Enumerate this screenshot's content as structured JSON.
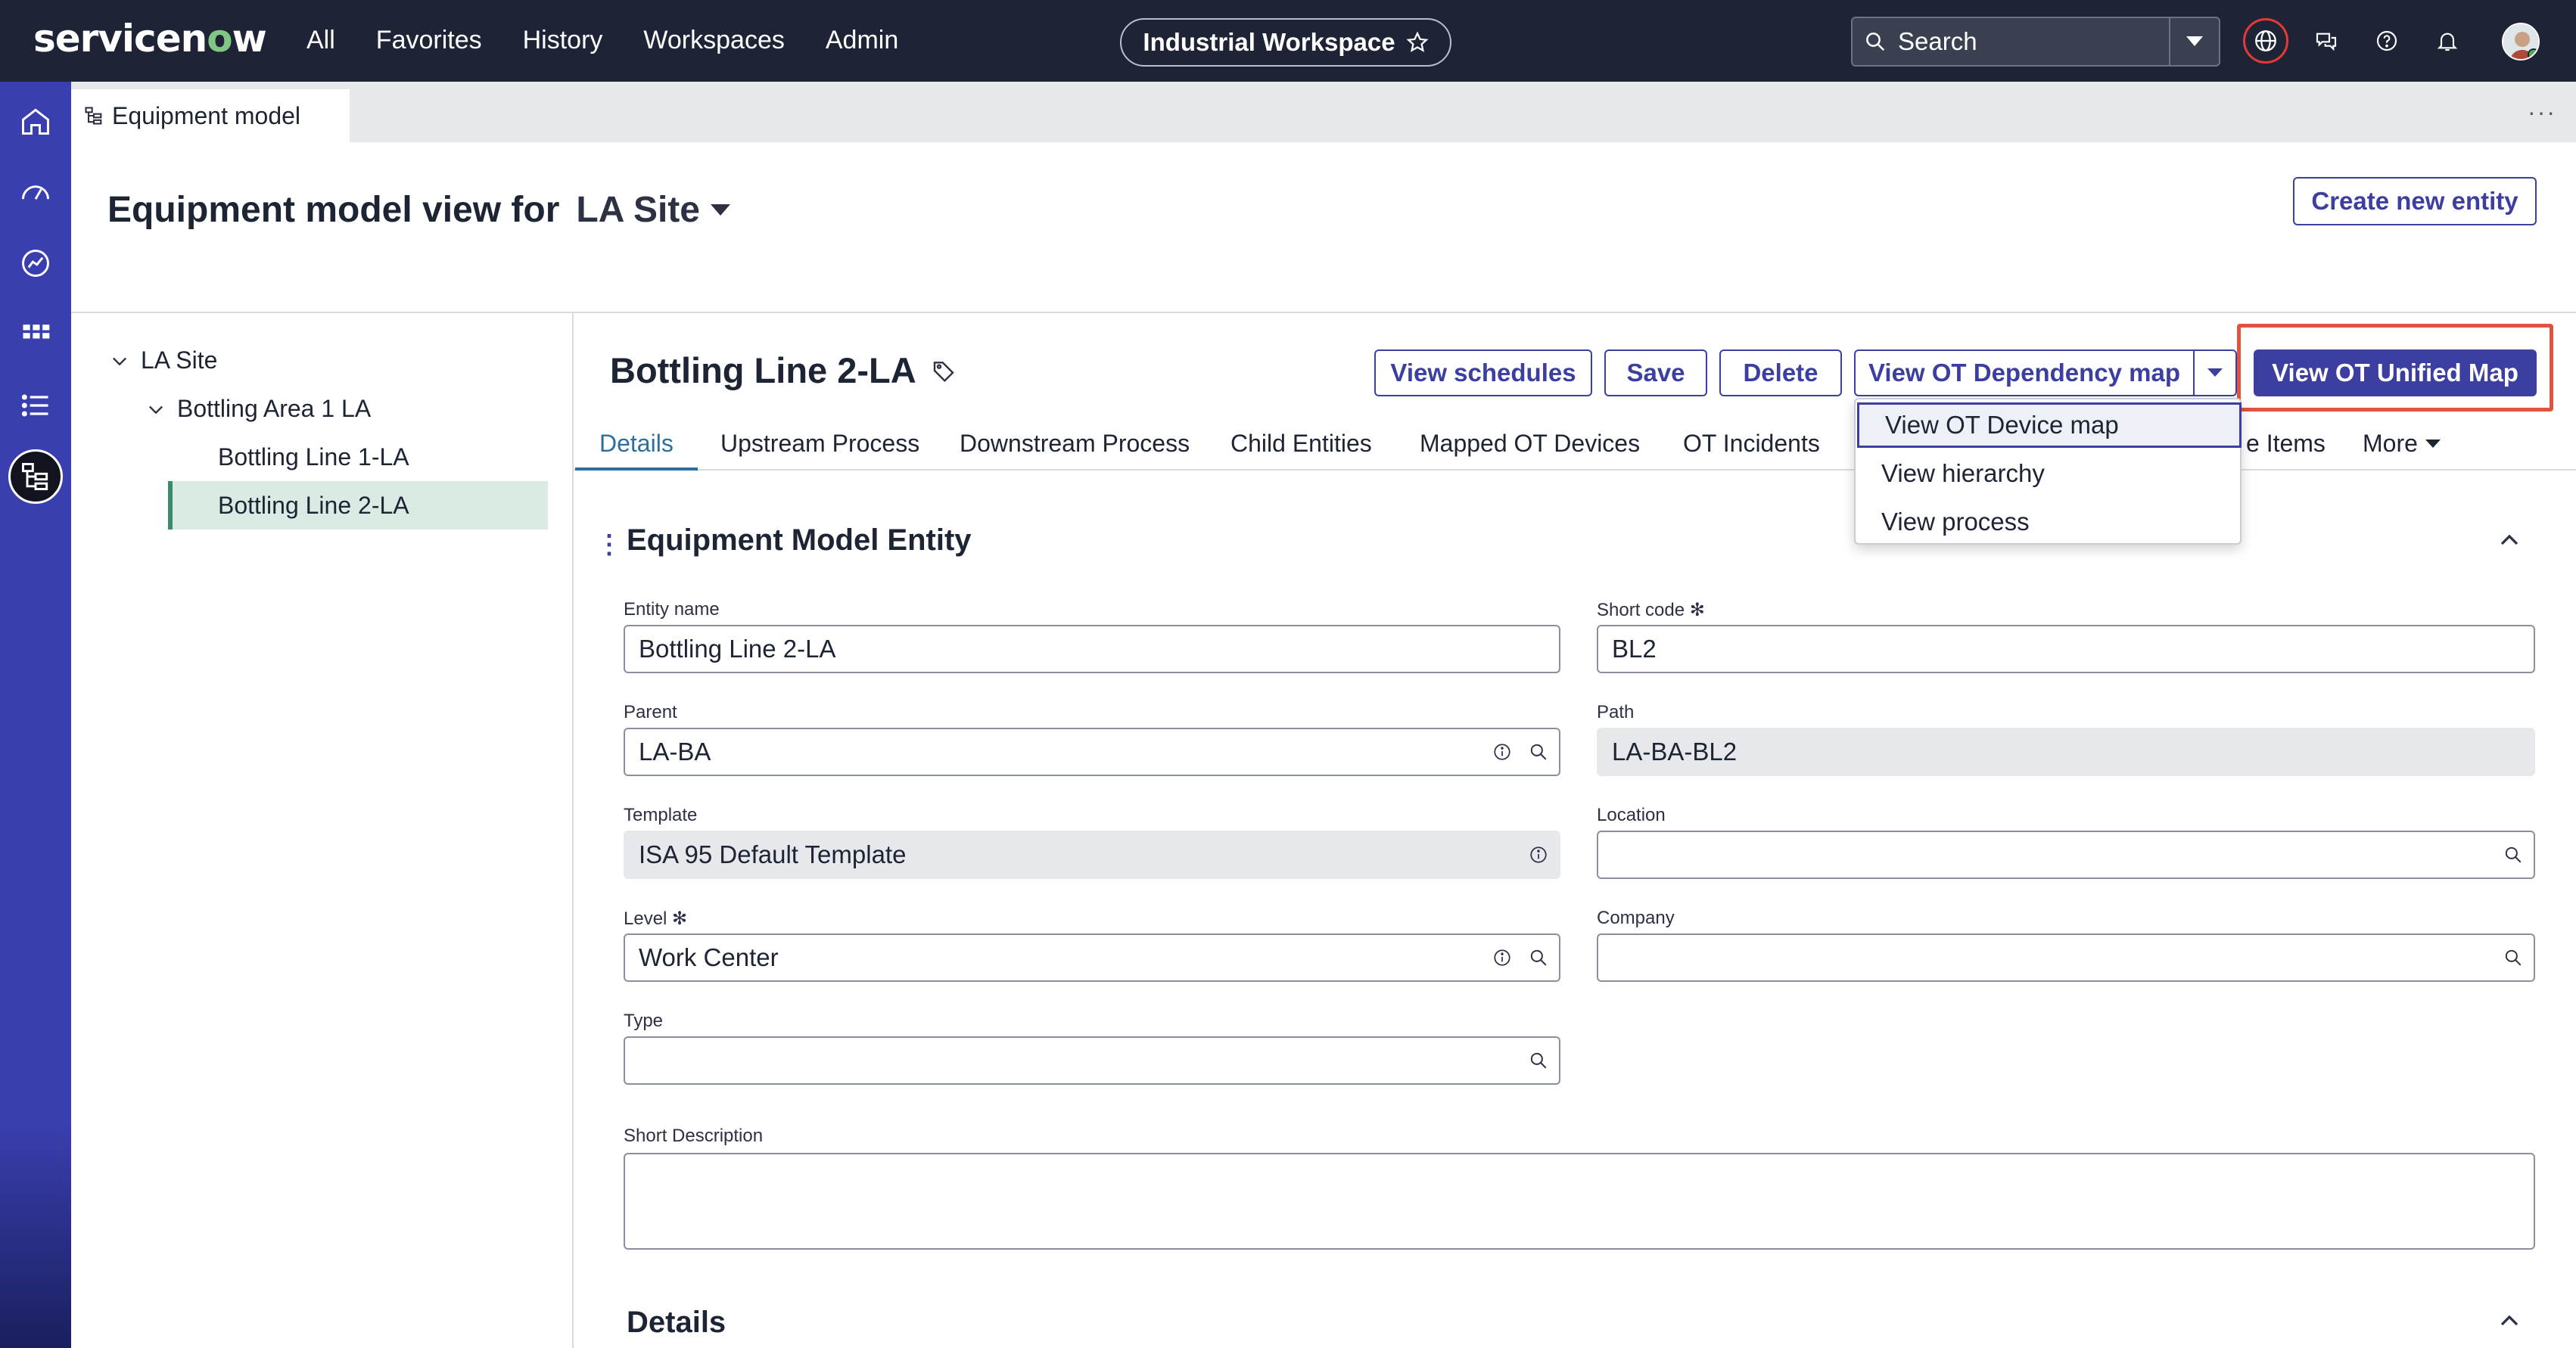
{
  "topnav": {
    "logo_prefix": "servicen",
    "logo_o": "o",
    "logo_suffix": "w",
    "links": [
      "All",
      "Favorites",
      "History",
      "Workspaces",
      "Admin"
    ],
    "workspace": "Industrial Workspace",
    "search_placeholder": "Search"
  },
  "tab": {
    "label": "Equipment model",
    "more": "···"
  },
  "header": {
    "title_prefix": "Equipment model view for",
    "site": "LA Site",
    "create_button": "Create new entity"
  },
  "tree": {
    "root": "LA Site",
    "area": "Bottling Area 1 LA",
    "line1": "Bottling Line 1-LA",
    "line2": "Bottling Line 2-LA"
  },
  "record": {
    "title": "Bottling Line 2-LA",
    "buttons": {
      "schedules": "View schedules",
      "save": "Save",
      "delete": "Delete",
      "dependency": "View OT Dependency map",
      "unified": "View OT Unified Map"
    },
    "tabs": [
      "Details",
      "Upstream Process",
      "Downstream Process",
      "Child Entities",
      "Mapped OT Devices",
      "OT Incidents",
      "e Items",
      "More"
    ],
    "dropdown": [
      "View OT Device map",
      "View hierarchy",
      "View process"
    ]
  },
  "section": {
    "title": "Equipment Model Entity",
    "details_title": "Details"
  },
  "fields": {
    "entity_name": {
      "label": "Entity name",
      "value": "Bottling Line 2-LA"
    },
    "short_code": {
      "label": "Short code",
      "value": "BL2"
    },
    "parent": {
      "label": "Parent",
      "value": "LA-BA"
    },
    "path": {
      "label": "Path",
      "value": "LA-BA-BL2"
    },
    "template": {
      "label": "Template",
      "value": "ISA 95 Default Template"
    },
    "location": {
      "label": "Location",
      "value": ""
    },
    "level": {
      "label": "Level",
      "value": "Work Center"
    },
    "company": {
      "label": "Company",
      "value": ""
    },
    "type": {
      "label": "Type",
      "value": ""
    },
    "short_description": {
      "label": "Short Description",
      "value": ""
    }
  },
  "colors": {
    "nav_bg": "#1e2436",
    "rail": "#3a3fb0",
    "primary": "#3c3fa0",
    "highlight": "#e0533c",
    "tab_active": "#2c6e9e",
    "tree_selected": "#d9ebe3"
  }
}
